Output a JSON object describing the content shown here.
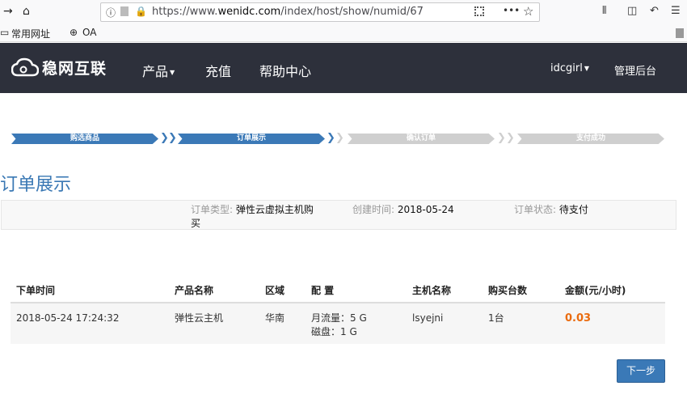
{
  "browser": {
    "url_prefix": "https://www.",
    "url_domain": "wenidc.com",
    "url_path": "/index/host/show/numid/67",
    "menu_dots": "•••"
  },
  "bookmarks": [
    {
      "label": "常用网址"
    },
    {
      "label": "OA"
    }
  ],
  "header": {
    "logo_text": "稳网互联",
    "nav": [
      {
        "label": "产品"
      },
      {
        "label": "充值"
      },
      {
        "label": "帮助中心"
      }
    ],
    "user": "idcgirl",
    "admin": "管理后台"
  },
  "steps": [
    {
      "label": "购选商品",
      "active": true
    },
    {
      "label": "订单展示",
      "active": true
    },
    {
      "label": "确认订单",
      "active": false
    },
    {
      "label": "支付成功",
      "active": false
    }
  ],
  "page_title": "订单展示",
  "order_info": {
    "type_label": "订单类型:",
    "type_value_line1": "弹性云虚拟主机购",
    "type_value_line2": "买",
    "created_label": "创建时间:",
    "created_value": "2018-05-24",
    "status_label": "订单状态:",
    "status_value": "待支付"
  },
  "table": {
    "headers": [
      "下单时间",
      "产品名称",
      "区域",
      "配 置",
      "主机名称",
      "购买台数",
      "金额(元/小时)"
    ],
    "rows": [
      {
        "time": "2018-05-24 17:24:32",
        "product": "弹性云主机",
        "region": "华南",
        "config_line1": "月流量：5 G",
        "config_line2": "磁盘：1 G",
        "host": "lsyejni",
        "count": "1台",
        "amount": "0.03"
      }
    ]
  },
  "next_button": "下一步",
  "colors": {
    "accent": "#3a78b4",
    "amount": "#ea6b0e",
    "header_bg": "#2d303b"
  }
}
